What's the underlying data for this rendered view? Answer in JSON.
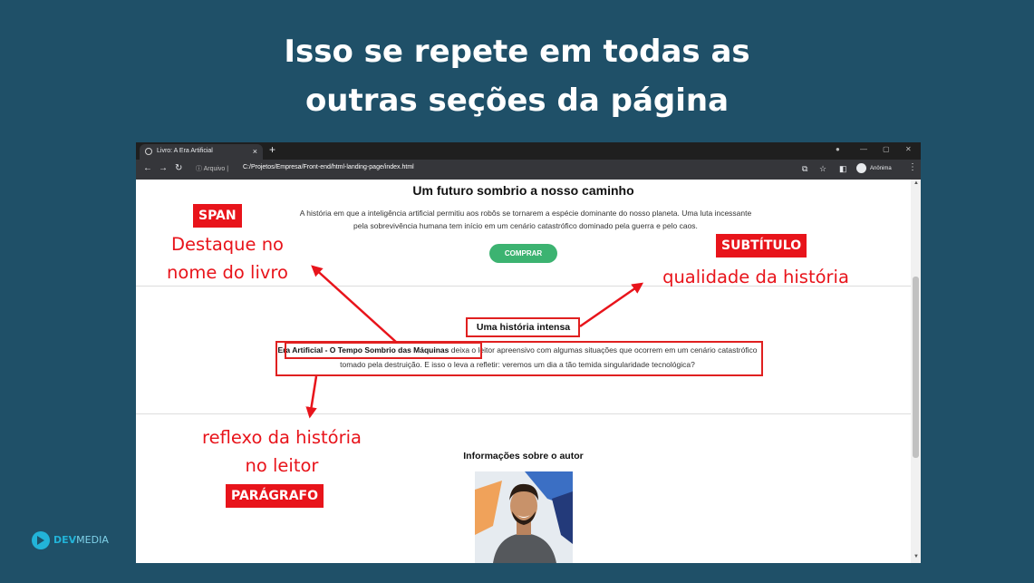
{
  "slide": {
    "title_line1": "Isso se repete em todas as",
    "title_line2": "outras seções da página"
  },
  "browser": {
    "tab_title": "Livro: A Era Artificial",
    "tab_close": "×",
    "new_tab": "+",
    "url_info": "Arquivo",
    "url": "C:/Projetos/Empresa/Front-end/html-landing-page/index.html",
    "profile": "Anônima"
  },
  "page": {
    "h1": "Um futuro sombrio a nosso caminho",
    "intro": "A história em que a inteligência artificial permitiu aos robôs se tornarem a espécie dominante do nosso planeta. Uma luta incessante pela sobrevivência humana tem início em um cenário catastrófico dominado pela guerra e pelo caos.",
    "buy_button": "COMPRAR",
    "subtitle": "Uma história intensa",
    "book_span": "Era Artificial - O Tempo Sombrio das Máquinas",
    "paragraph_rest": " deixa o leitor apreensivo com algumas situações que ocorrem em um cenário catastrófico tomado pela destruição. E isso o leva a refletir: veremos um dia a tão temida singularidade tecnológica?",
    "author_heading": "Informações sobre o autor"
  },
  "annotations": {
    "span_tag": "SPAN",
    "span_note_line1": "Destaque no",
    "span_note_line2": "nome do livro",
    "subtitle_tag": "SUBTÍTULO",
    "subtitle_note": "qualidade da história",
    "paragraph_note_line1": "reflexo da história",
    "paragraph_note_line2": "no leitor",
    "paragraph_tag": "PARÁGRAFO"
  },
  "logo": {
    "part1": "DEV",
    "part2": "MEDIA"
  },
  "colors": {
    "background": "#1f5068",
    "annotation_red": "#e8141b",
    "button_green": "#3cb371",
    "logo_blue": "#22b3d8"
  }
}
